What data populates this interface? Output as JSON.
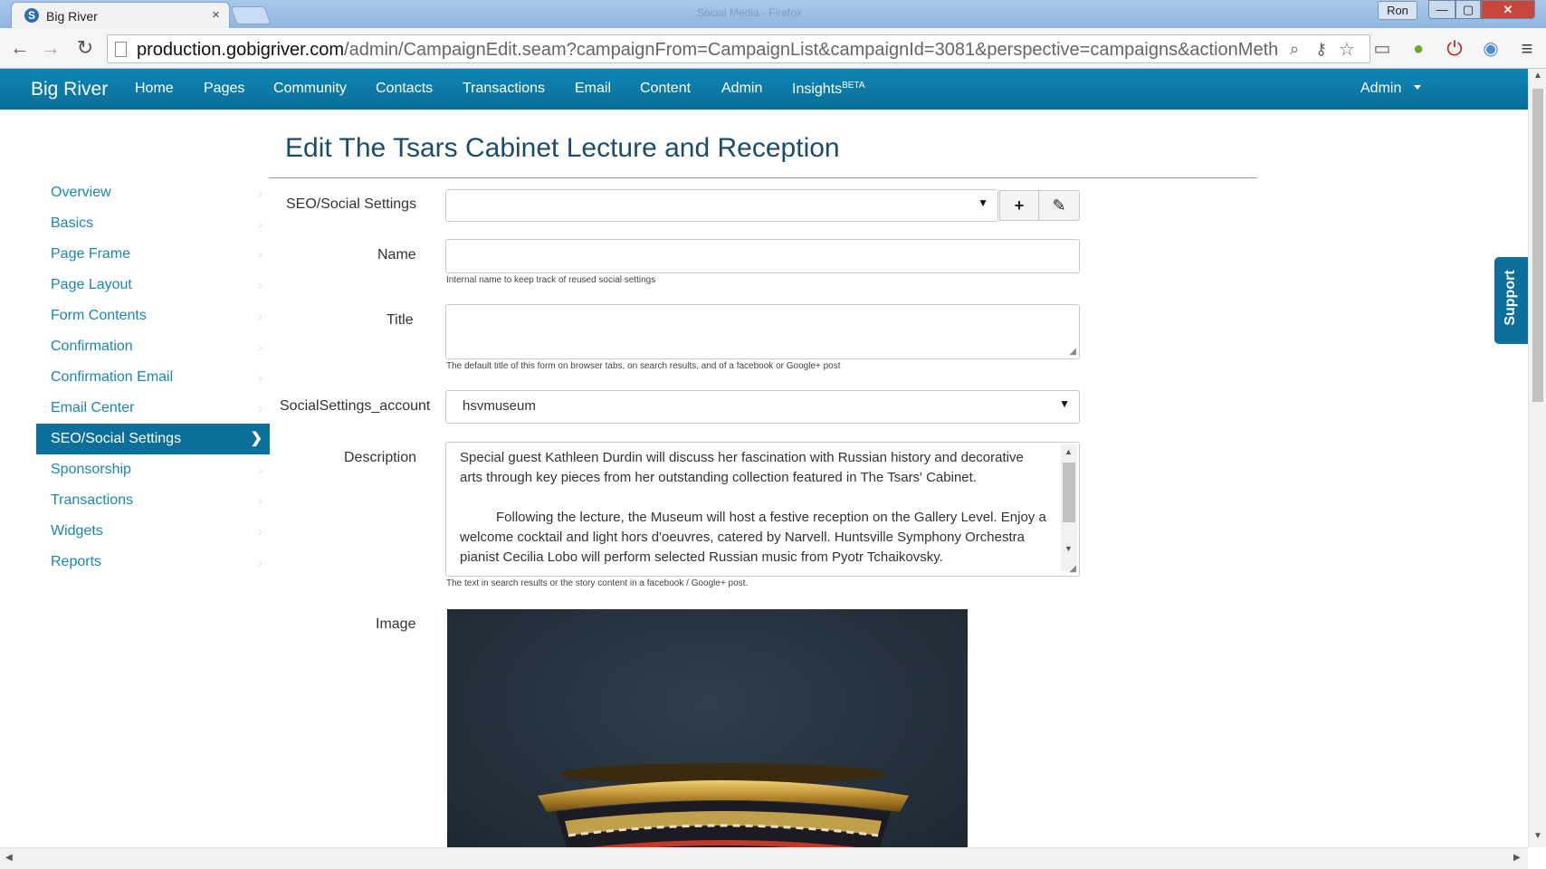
{
  "browser": {
    "tab_title": "Big River",
    "tab_close": "×",
    "faded_window_title": "Social Media - Firefox",
    "user_badge": "Ron",
    "win_min": "—",
    "win_max": "▢",
    "win_close": "✕",
    "url_host": "production.gobigriver.com",
    "url_path": "/admin/CampaignEdit.seam?campaignFrom=CampaignList&campaignId=3081&perspective=campaigns&actionMeth"
  },
  "appnav": {
    "brand": "Big River",
    "items": [
      "Home",
      "Pages",
      "Community",
      "Contacts",
      "Transactions",
      "Email",
      "Content",
      "Admin"
    ],
    "insights": "Insights",
    "insights_badge": "BETA",
    "admin_menu": "Admin"
  },
  "page": {
    "title": "Edit The Tsars Cabinet Lecture and Reception"
  },
  "sidebar": {
    "items": [
      {
        "label": "Overview"
      },
      {
        "label": "Basics"
      },
      {
        "label": "Page Frame"
      },
      {
        "label": "Page Layout"
      },
      {
        "label": "Form Contents"
      },
      {
        "label": "Confirmation"
      },
      {
        "label": "Confirmation Email"
      },
      {
        "label": "Email Center"
      },
      {
        "label": "SEO/Social Settings"
      },
      {
        "label": "Sponsorship"
      },
      {
        "label": "Transactions"
      },
      {
        "label": "Widgets"
      },
      {
        "label": "Reports"
      }
    ],
    "active_index": 8
  },
  "form": {
    "seo_label": "SEO/Social Settings",
    "seo_value": "",
    "add_btn": "+",
    "edit_btn": "✎",
    "name_label": "Name",
    "name_value": "",
    "name_help": "Internal name to keep track of reused social settings",
    "title_label": "Title",
    "title_value": "",
    "title_help": "The default title of this form on browser tabs, on search results, and of a facebook or Google+ post",
    "account_label": "SocialSettings_account",
    "account_value": "hsvmuseum",
    "description_label": "Description",
    "description_p1": "Special guest Kathleen Durdin will discuss her fascination with Russian history and decorative arts through key pieces from her outstanding collection featured in The Tsars' Cabinet.",
    "description_p2": "Following the lecture, the Museum will host a festive reception on the Gallery Level. Enjoy a welcome cocktail and light hors d'oeuvres, catered by Narvell. Huntsville Symphony Orchestra pianist Cecilia Lobo will perform selected Russian music from Pyotr Tchaikovsky.",
    "description_help": "The text in search results or the story content in a facebook / Google+ post.",
    "image_label": "Image"
  },
  "support": {
    "label": "Support"
  },
  "colors": {
    "nav_blue": "#0d6f9b",
    "link_blue": "#1a86b3",
    "title_blue": "#1b4d6b"
  }
}
